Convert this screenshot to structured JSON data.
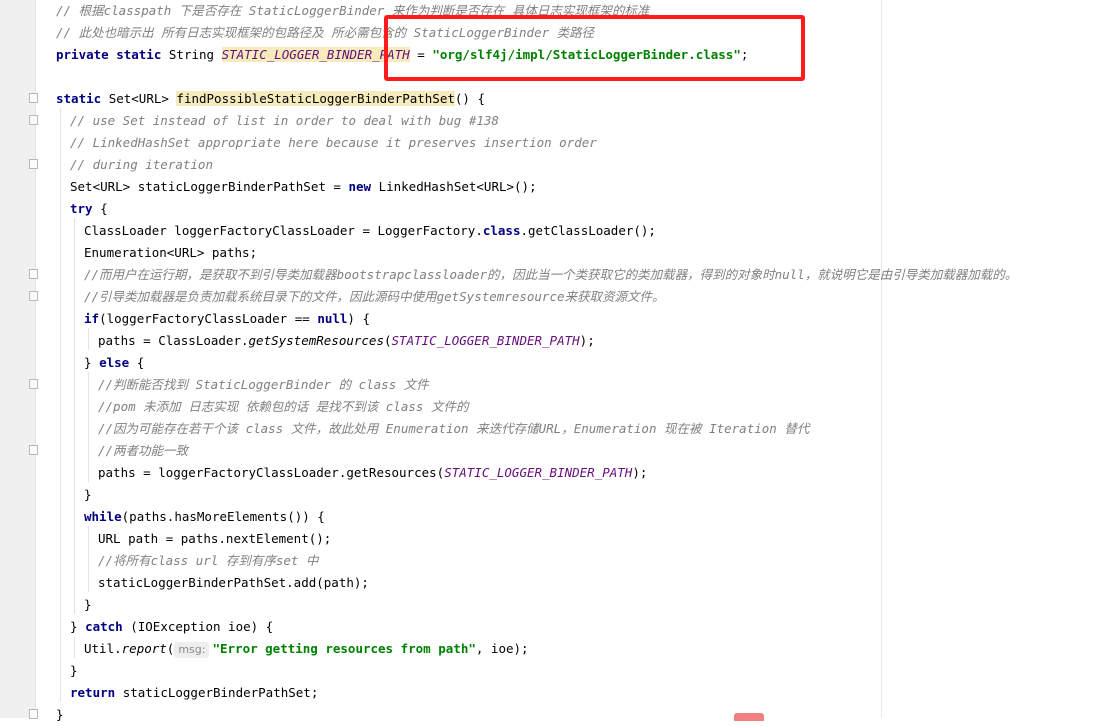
{
  "editor": {
    "lines": [
      {
        "segs": [
          [
            "cm",
            "// 根据"
          ],
          [
            "cm",
            "classpath"
          ],
          [
            "cm",
            " 下是否存在 "
          ],
          [
            "cm",
            "StaticLoggerBinder"
          ],
          [
            "cm",
            " 来作为判断是否存在 具体日志实现框架的标准"
          ]
        ]
      },
      {
        "segs": [
          [
            "cm",
            "// 此处也暗示出 所有日志实现框架的包路径及 所必需包含的 "
          ],
          [
            "cm",
            "StaticLoggerBinder"
          ],
          [
            "cm",
            " 类路径"
          ]
        ]
      },
      {
        "segs": [
          [
            "kw",
            "private static "
          ],
          [
            "t",
            "String "
          ],
          [
            "fihl",
            "STATIC_LOGGER_BINDER_PATH"
          ],
          [
            "t",
            " = "
          ],
          [
            "st",
            "\"org/slf4j/impl/StaticLoggerBinder.class\""
          ],
          [
            "t",
            ";"
          ]
        ]
      },
      {
        "segs": []
      },
      {
        "segs": [
          [
            "kw",
            "static "
          ],
          [
            "t",
            "Set<URL> "
          ],
          [
            "hl",
            "findPossibleStaticLoggerBinderPathSet"
          ],
          [
            "t",
            "() {"
          ]
        ]
      },
      {
        "segs": [
          [
            "cm",
            "// use Set instead of list in order to deal with bug #138"
          ]
        ]
      },
      {
        "segs": [
          [
            "cm",
            "// LinkedHashSet appropriate here because it preserves insertion order"
          ]
        ]
      },
      {
        "segs": [
          [
            "cm",
            "// during iteration"
          ]
        ]
      },
      {
        "segs": [
          [
            "t",
            "Set<URL> staticLoggerBinderPathSet = "
          ],
          [
            "kw",
            "new "
          ],
          [
            "t",
            "LinkedHashSet<URL>();"
          ]
        ]
      },
      {
        "segs": [
          [
            "kw",
            "try "
          ],
          [
            "t",
            "{"
          ]
        ]
      },
      {
        "segs": [
          [
            "t",
            "ClassLoader loggerFactoryClassLoader = LoggerFactory."
          ],
          [
            "kw",
            "class"
          ],
          [
            "t",
            ".getClassLoader();"
          ]
        ]
      },
      {
        "segs": [
          [
            "t",
            "Enumeration<URL> paths;"
          ]
        ]
      },
      {
        "segs": [
          [
            "cm",
            "//而用户在运行期，是获取不到引导类加载器"
          ],
          [
            "cm",
            "bootstrapclassloader"
          ],
          [
            "cm",
            "的，因此当一个类获取它的类加载器，得到的对象时"
          ],
          [
            "cm",
            "null"
          ],
          [
            "cm",
            "，就说明它是由引导类加载器加载的。"
          ]
        ]
      },
      {
        "segs": [
          [
            "cm",
            "//引导类加载器是负责加载系统目录下的文件，因此源码中使用"
          ],
          [
            "cm",
            "getSystemresource"
          ],
          [
            "cm",
            "来获取资源文件。"
          ]
        ]
      },
      {
        "segs": [
          [
            "kw",
            "if"
          ],
          [
            "t",
            "(loggerFactoryClassLoader == "
          ],
          [
            "kw",
            "null"
          ],
          [
            "t",
            ") {"
          ]
        ]
      },
      {
        "segs": [
          [
            "t",
            "paths = ClassLoader."
          ],
          [
            "mi",
            "getSystemResources"
          ],
          [
            "t",
            "("
          ],
          [
            "fi",
            "STATIC_LOGGER_BINDER_PATH"
          ],
          [
            "t",
            ");"
          ]
        ]
      },
      {
        "segs": [
          [
            "t",
            "} "
          ],
          [
            "kw",
            "else "
          ],
          [
            "t",
            "{"
          ]
        ]
      },
      {
        "segs": [
          [
            "cm",
            "//判断能否找到 "
          ],
          [
            "cm",
            "StaticLoggerBinder"
          ],
          [
            "cm",
            " 的 "
          ],
          [
            "cm",
            "class"
          ],
          [
            "cm",
            " 文件"
          ]
        ]
      },
      {
        "segs": [
          [
            "cm",
            "//pom"
          ],
          [
            "cm",
            " 未添加 日志实现 依赖包的话 是找不到该 "
          ],
          [
            "cm",
            "class"
          ],
          [
            "cm",
            " 文件的"
          ]
        ]
      },
      {
        "segs": [
          [
            "cm",
            "//因为可能存在若干个该 "
          ],
          [
            "cm",
            "class"
          ],
          [
            "cm",
            " 文件，故此处用 "
          ],
          [
            "cm",
            "Enumeration"
          ],
          [
            "cm",
            " 来迭代存储"
          ],
          [
            "cm",
            "URL"
          ],
          [
            "cm",
            "，"
          ],
          [
            "cm",
            "Enumeration"
          ],
          [
            "cm",
            " 现在被 "
          ],
          [
            "cm",
            "Iteration"
          ],
          [
            "cm",
            " 替代"
          ]
        ]
      },
      {
        "segs": [
          [
            "cm",
            "//两者功能一致"
          ]
        ]
      },
      {
        "segs": [
          [
            "t",
            "paths = loggerFactoryClassLoader.getResources("
          ],
          [
            "fi",
            "STATIC_LOGGER_BINDER_PATH"
          ],
          [
            "t",
            ");"
          ]
        ]
      },
      {
        "segs": [
          [
            "t",
            "}"
          ]
        ]
      },
      {
        "segs": [
          [
            "kw",
            "while"
          ],
          [
            "t",
            "(paths.hasMoreElements()) {"
          ]
        ]
      },
      {
        "segs": [
          [
            "t",
            "URL path = paths.nextElement();"
          ]
        ]
      },
      {
        "segs": [
          [
            "cm",
            "//将所有"
          ],
          [
            "cm",
            "class url"
          ],
          [
            "cm",
            " 存到有序"
          ],
          [
            "cm",
            "set"
          ],
          [
            "cm",
            " 中"
          ]
        ]
      },
      {
        "segs": [
          [
            "t",
            "staticLoggerBinderPathSet.add(path);"
          ]
        ]
      },
      {
        "segs": [
          [
            "t",
            "}"
          ]
        ]
      },
      {
        "segs": [
          [
            "t",
            "} "
          ],
          [
            "kw",
            "catch "
          ],
          [
            "t",
            "(IOException ioe) {"
          ]
        ]
      },
      {
        "segs": [
          [
            "t",
            "Util."
          ],
          [
            "mi",
            "report"
          ],
          [
            "t",
            "("
          ],
          [
            "hint",
            "msg:"
          ],
          [
            "st",
            "\"Error getting resources from path\""
          ],
          [
            "t",
            ", ioe);"
          ]
        ]
      },
      {
        "segs": [
          [
            "t",
            "}"
          ]
        ]
      },
      {
        "segs": [
          [
            "kw",
            "return "
          ],
          [
            "t",
            "staticLoggerBinderPathSet;"
          ]
        ]
      },
      {
        "segs": [
          [
            "t",
            "}"
          ]
        ]
      }
    ]
  }
}
